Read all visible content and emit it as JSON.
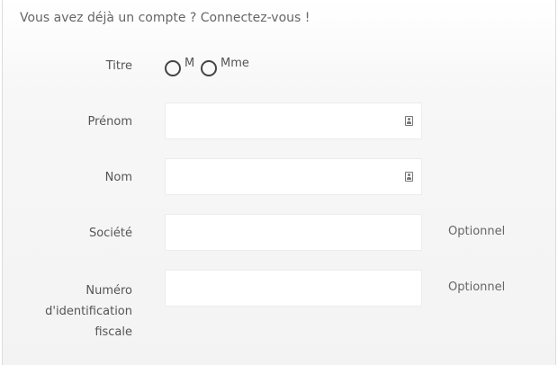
{
  "login_prompt": "Vous avez déjà un compte ? Connectez-vous !",
  "title_field": {
    "label": "Titre",
    "options": [
      "M",
      "Mme"
    ],
    "selected": null
  },
  "first_name": {
    "label": "Prénom",
    "value": "",
    "icon": "contact-card-icon"
  },
  "last_name": {
    "label": "Nom",
    "value": "",
    "icon": "contact-card-icon"
  },
  "company": {
    "label": "Société",
    "value": "",
    "hint": "Optionnel"
  },
  "tax_id": {
    "label_lines": [
      "Numéro",
      "d'identification",
      "fiscale"
    ],
    "value": "",
    "hint": "Optionnel"
  }
}
